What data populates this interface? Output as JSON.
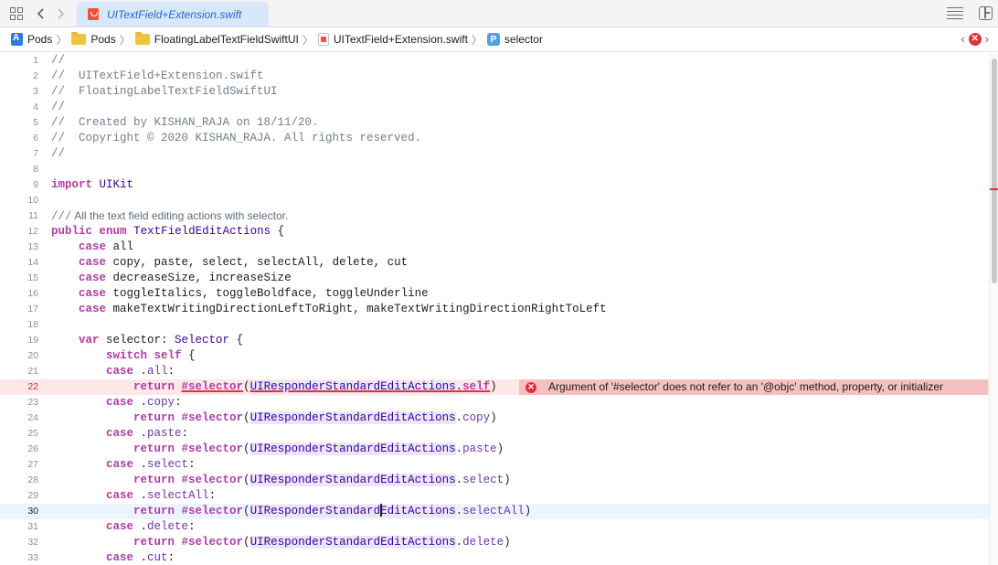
{
  "tab": {
    "title": "UITextField+Extension.swift"
  },
  "breadcrumbs": [
    {
      "label": "Pods",
      "icon": "project-icon"
    },
    {
      "label": "Pods",
      "icon": "folder-icon"
    },
    {
      "label": "FloatingLabelTextFieldSwiftUI",
      "icon": "folder-icon"
    },
    {
      "label": "UITextField+Extension.swift",
      "icon": "swift-file-icon"
    },
    {
      "label": "selector",
      "icon": "property-icon"
    }
  ],
  "error_message": "Argument of '#selector' does not refer to an '@objc' method, property, or initializer",
  "current_line": "30",
  "error_line": "22",
  "lines": [
    {
      "n": "1",
      "t": "//"
    },
    {
      "n": "2",
      "t": "//  UITextField+Extension.swift"
    },
    {
      "n": "3",
      "t": "//  FloatingLabelTextFieldSwiftUI"
    },
    {
      "n": "4",
      "t": "//"
    },
    {
      "n": "5",
      "t": "//  Created by KISHAN_RAJA on 18/11/20."
    },
    {
      "n": "6",
      "t": "//  Copyright © 2020 KISHAN_RAJA. All rights reserved."
    },
    {
      "n": "7",
      "t": "//"
    },
    {
      "n": "8",
      "t": ""
    },
    {
      "n": "9",
      "t": "import UIKit"
    },
    {
      "n": "10",
      "t": ""
    },
    {
      "n": "11",
      "t": "/// All the text field editing actions with selector."
    },
    {
      "n": "12",
      "t": "public enum TextFieldEditActions {"
    },
    {
      "n": "13",
      "t": "    case all"
    },
    {
      "n": "14",
      "t": "    case copy, paste, select, selectAll, delete, cut"
    },
    {
      "n": "15",
      "t": "    case decreaseSize, increaseSize"
    },
    {
      "n": "16",
      "t": "    case toggleItalics, toggleBoldface, toggleUnderline"
    },
    {
      "n": "17",
      "t": "    case makeTextWritingDirectionLeftToRight, makeTextWritingDirectionRightToLeft"
    },
    {
      "n": "18",
      "t": ""
    },
    {
      "n": "19",
      "t": "    var selector: Selector {"
    },
    {
      "n": "20",
      "t": "        switch self {"
    },
    {
      "n": "21",
      "t": "        case .all:"
    },
    {
      "n": "22",
      "t": "            return #selector(UIResponderStandardEditActions.self)"
    },
    {
      "n": "23",
      "t": "        case .copy:"
    },
    {
      "n": "24",
      "t": "            return #selector(UIResponderStandardEditActions.copy)"
    },
    {
      "n": "25",
      "t": "        case .paste:"
    },
    {
      "n": "26",
      "t": "            return #selector(UIResponderStandardEditActions.paste)"
    },
    {
      "n": "27",
      "t": "        case .select:"
    },
    {
      "n": "28",
      "t": "            return #selector(UIResponderStandardEditActions.select)"
    },
    {
      "n": "29",
      "t": "        case .selectAll:"
    },
    {
      "n": "30",
      "t": "            return #selector(UIResponderStandardEditActions.selectAll)"
    },
    {
      "n": "31",
      "t": "        case .delete:"
    },
    {
      "n": "32",
      "t": "            return #selector(UIResponderStandardEditActions.delete)"
    },
    {
      "n": "33",
      "t": "        case .cut:"
    }
  ],
  "colors": {
    "keyword": "#ad3da4",
    "comment": "#707f8c",
    "type": "#3900a0",
    "member": "#6c36a9",
    "error": "#e0313b",
    "current_line": "#ecf5ff",
    "tab_active": "#d8e8fa",
    "tab_text": "#1a6ccf"
  }
}
